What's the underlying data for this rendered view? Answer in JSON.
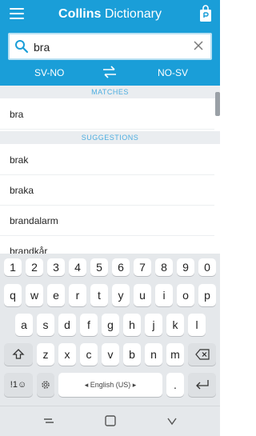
{
  "header": {
    "brand": "Collins",
    "subtitle": " Dictionary",
    "colors": {
      "header_bg": "#1a9ed8",
      "accent": "#4eaee0"
    }
  },
  "search": {
    "value": "bra",
    "placeholder": ""
  },
  "languages": {
    "from": "SV-NO",
    "to": "NO-SV"
  },
  "matches": {
    "header": "MATCHES",
    "items": [
      "bra"
    ]
  },
  "suggestions": {
    "header": "SUGGESTIONS",
    "items": [
      "brak",
      "braka",
      "brandalarm",
      "brandkår"
    ]
  },
  "keyboard": {
    "numbers": [
      "1",
      "2",
      "3",
      "4",
      "5",
      "6",
      "7",
      "8",
      "9",
      "0"
    ],
    "row1": [
      "q",
      "w",
      "e",
      "r",
      "t",
      "y",
      "u",
      "i",
      "o",
      "p"
    ],
    "row2": [
      "a",
      "s",
      "d",
      "f",
      "g",
      "h",
      "j",
      "k",
      "l"
    ],
    "row3": [
      "z",
      "x",
      "c",
      "v",
      "b",
      "n",
      "m"
    ],
    "symbols_key": "!1☺",
    "space_label": "◂ English (US) ▸",
    "period": ".",
    "shift_icon": "shift-icon",
    "backspace_icon": "backspace-icon",
    "enter_icon": "enter-icon",
    "settings_icon": "gear-icon"
  },
  "navbar": {
    "icons": [
      "recent-apps-icon",
      "home-icon",
      "back-icon"
    ]
  }
}
